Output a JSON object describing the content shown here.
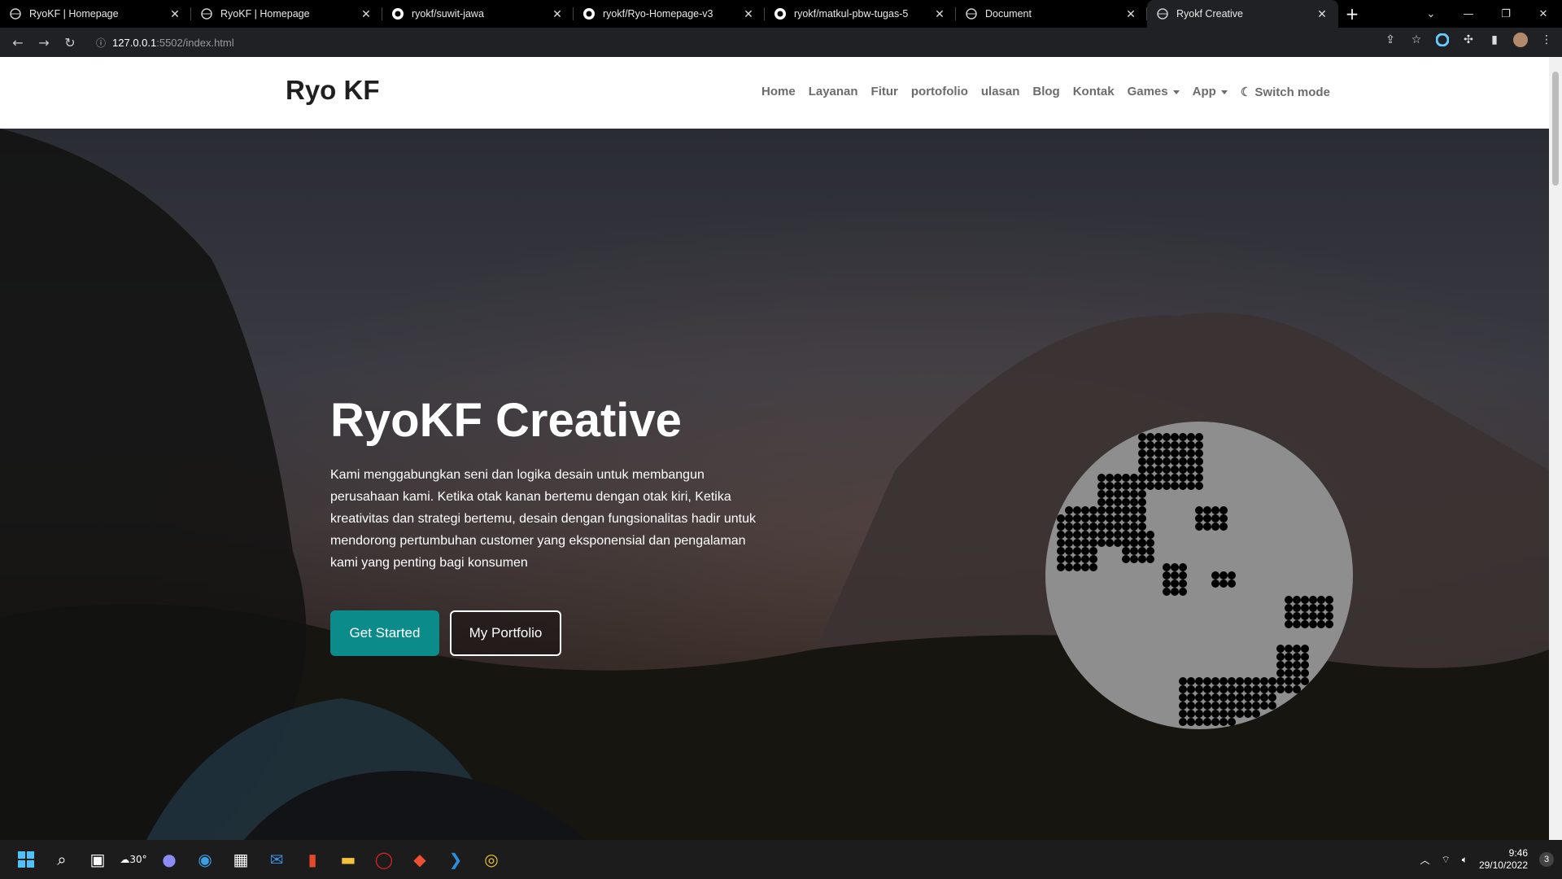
{
  "browser": {
    "tabs": [
      {
        "title": "RyoKF | Homepage",
        "icon": "globe-icon",
        "active": false
      },
      {
        "title": "RyoKF | Homepage",
        "icon": "globe-icon",
        "active": false
      },
      {
        "title": "ryokf/suwit-jawa",
        "icon": "github-icon",
        "active": false
      },
      {
        "title": "ryokf/Ryo-Homepage-v3",
        "icon": "github-icon",
        "active": false
      },
      {
        "title": "ryokf/matkul-pbw-tugas-5",
        "icon": "github-icon",
        "active": false
      },
      {
        "title": "Document",
        "icon": "globe-icon",
        "active": false
      },
      {
        "title": "Ryokf Creative",
        "icon": "globe-icon",
        "active": true
      }
    ],
    "url_host": "127.0.0.1",
    "url_path": ":5502/index.html"
  },
  "page": {
    "brand": "Ryo KF",
    "nav": [
      "Home",
      "Layanan",
      "Fitur",
      "portofolio",
      "ulasan",
      "Blog",
      "Kontak"
    ],
    "nav_games": "Games",
    "nav_app": "App",
    "nav_switch": "Switch mode",
    "hero_title": "RyoKF Creative",
    "hero_text": "Kami menggabungkan seni dan logika desain untuk membangun perusahaan kami. Ketika otak kanan bertemu dengan otak kiri, Ketika kreativitas dan strategi bertemu, desain dengan fungsionalitas hadir untuk mendorong pertumbuhan customer yang eksponensial dan pengalaman kami yang penting bagi konsumen",
    "btn_primary": "Get Started",
    "btn_secondary": "My Portfolio",
    "colors": {
      "accent": "#0b8c8a",
      "globe": "#8e8e8e"
    }
  },
  "taskbar": {
    "weather": "30°",
    "time": "9:46",
    "date": "29/10/2022",
    "notifications": "3"
  }
}
